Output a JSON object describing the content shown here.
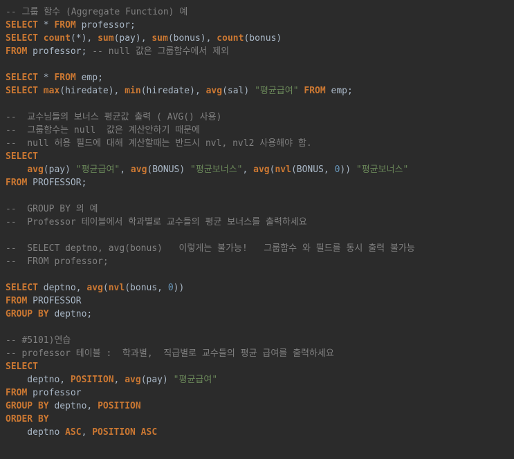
{
  "lines": [
    [
      {
        "cls": "comment",
        "t": "-- 그룹 함수 (Aggregate Function) 예"
      }
    ],
    [
      {
        "cls": "keyword",
        "t": "SELECT"
      },
      {
        "cls": "ident",
        "t": " * "
      },
      {
        "cls": "keyword",
        "t": "FROM"
      },
      {
        "cls": "ident",
        "t": " professor;"
      }
    ],
    [
      {
        "cls": "keyword",
        "t": "SELECT"
      },
      {
        "cls": "ident",
        "t": " "
      },
      {
        "cls": "keyword",
        "t": "count"
      },
      {
        "cls": "paren",
        "t": "(*), "
      },
      {
        "cls": "keyword",
        "t": "sum"
      },
      {
        "cls": "paren",
        "t": "(pay), "
      },
      {
        "cls": "keyword",
        "t": "sum"
      },
      {
        "cls": "paren",
        "t": "(bonus), "
      },
      {
        "cls": "keyword",
        "t": "count"
      },
      {
        "cls": "paren",
        "t": "(bonus)"
      }
    ],
    [
      {
        "cls": "keyword",
        "t": "FROM"
      },
      {
        "cls": "ident",
        "t": " professor; "
      },
      {
        "cls": "comment",
        "t": "-- null 값은 그룹함수에서 제외"
      }
    ],
    [
      {
        "cls": "ident",
        "t": ""
      }
    ],
    [
      {
        "cls": "keyword",
        "t": "SELECT"
      },
      {
        "cls": "ident",
        "t": " * "
      },
      {
        "cls": "keyword",
        "t": "FROM"
      },
      {
        "cls": "ident",
        "t": " emp;"
      }
    ],
    [
      {
        "cls": "keyword",
        "t": "SELECT"
      },
      {
        "cls": "ident",
        "t": " "
      },
      {
        "cls": "keyword",
        "t": "max"
      },
      {
        "cls": "paren",
        "t": "(hiredate), "
      },
      {
        "cls": "keyword",
        "t": "min"
      },
      {
        "cls": "paren",
        "t": "(hiredate), "
      },
      {
        "cls": "keyword",
        "t": "avg"
      },
      {
        "cls": "paren",
        "t": "(sal) "
      },
      {
        "cls": "string",
        "t": "\"평균급여\""
      },
      {
        "cls": "ident",
        "t": " "
      },
      {
        "cls": "keyword",
        "t": "FROM"
      },
      {
        "cls": "ident",
        "t": " emp;"
      }
    ],
    [
      {
        "cls": "ident",
        "t": ""
      }
    ],
    [
      {
        "cls": "comment",
        "t": "--  교수님들의 보너스 평균값 출력 ( AVG() 사용)"
      }
    ],
    [
      {
        "cls": "comment",
        "t": "--  그룹함수는 null  값은 계산안하기 때문에"
      }
    ],
    [
      {
        "cls": "comment",
        "t": "--  null 허용 필드에 대해 계산할때는 반드시 nvl, nvl2 사용해야 함."
      }
    ],
    [
      {
        "cls": "keyword",
        "t": "SELECT"
      }
    ],
    [
      {
        "cls": "ident",
        "t": "    "
      },
      {
        "cls": "keyword",
        "t": "avg"
      },
      {
        "cls": "paren",
        "t": "(pay) "
      },
      {
        "cls": "string",
        "t": "\"평균급여\""
      },
      {
        "cls": "paren",
        "t": ", "
      },
      {
        "cls": "keyword",
        "t": "avg"
      },
      {
        "cls": "paren",
        "t": "(BONUS) "
      },
      {
        "cls": "string",
        "t": "\"평균보너스\""
      },
      {
        "cls": "paren",
        "t": ", "
      },
      {
        "cls": "keyword",
        "t": "avg"
      },
      {
        "cls": "paren",
        "t": "("
      },
      {
        "cls": "keyword",
        "t": "nvl"
      },
      {
        "cls": "paren",
        "t": "(BONUS, "
      },
      {
        "cls": "num",
        "t": "0"
      },
      {
        "cls": "paren",
        "t": ")) "
      },
      {
        "cls": "string",
        "t": "\"평균보너스\""
      }
    ],
    [
      {
        "cls": "keyword",
        "t": "FROM"
      },
      {
        "cls": "ident",
        "t": " PROFESSOR;"
      }
    ],
    [
      {
        "cls": "ident",
        "t": ""
      }
    ],
    [
      {
        "cls": "comment",
        "t": "--  GROUP BY 의 예"
      }
    ],
    [
      {
        "cls": "comment",
        "t": "--  Professor 테이블에서 학과별로 교수들의 평균 보너스를 출력하세요"
      }
    ],
    [
      {
        "cls": "ident",
        "t": ""
      }
    ],
    [
      {
        "cls": "comment",
        "t": "--  SELECT deptno, avg(bonus)   이렇게는 불가능!   그룹함수 와 필드를 동시 출력 불가능"
      }
    ],
    [
      {
        "cls": "comment",
        "t": "--  FROM professor;"
      }
    ],
    [
      {
        "cls": "ident",
        "t": ""
      }
    ],
    [
      {
        "cls": "keyword",
        "t": "SELECT"
      },
      {
        "cls": "ident",
        "t": " deptno, "
      },
      {
        "cls": "keyword",
        "t": "avg"
      },
      {
        "cls": "paren",
        "t": "("
      },
      {
        "cls": "keyword",
        "t": "nvl"
      },
      {
        "cls": "paren",
        "t": "(bonus, "
      },
      {
        "cls": "num",
        "t": "0"
      },
      {
        "cls": "paren",
        "t": "))"
      }
    ],
    [
      {
        "cls": "keyword",
        "t": "FROM"
      },
      {
        "cls": "ident",
        "t": " PROFESSOR"
      }
    ],
    [
      {
        "cls": "keyword",
        "t": "GROUP BY"
      },
      {
        "cls": "ident",
        "t": " deptno;"
      }
    ],
    [
      {
        "cls": "ident",
        "t": ""
      }
    ],
    [
      {
        "cls": "comment",
        "t": "-- #5101)연습"
      }
    ],
    [
      {
        "cls": "comment",
        "t": "-- professor 테이블 :  학과별,  직급별로 교수들의 평균 급여를 출력하세요"
      }
    ],
    [
      {
        "cls": "keyword",
        "t": "SELECT"
      }
    ],
    [
      {
        "cls": "ident",
        "t": "    deptno, "
      },
      {
        "cls": "keyword",
        "t": "POSITION"
      },
      {
        "cls": "ident",
        "t": ", "
      },
      {
        "cls": "keyword",
        "t": "avg"
      },
      {
        "cls": "paren",
        "t": "(pay) "
      },
      {
        "cls": "string",
        "t": "\"평균급여\""
      }
    ],
    [
      {
        "cls": "keyword",
        "t": "FROM"
      },
      {
        "cls": "ident",
        "t": " professor"
      }
    ],
    [
      {
        "cls": "keyword",
        "t": "GROUP BY"
      },
      {
        "cls": "ident",
        "t": " deptno, "
      },
      {
        "cls": "keyword",
        "t": "POSITION"
      }
    ],
    [
      {
        "cls": "keyword",
        "t": "ORDER BY"
      }
    ],
    [
      {
        "cls": "ident",
        "t": "    deptno "
      },
      {
        "cls": "keyword",
        "t": "ASC"
      },
      {
        "cls": "ident",
        "t": ", "
      },
      {
        "cls": "keyword",
        "t": "POSITION ASC"
      }
    ]
  ]
}
